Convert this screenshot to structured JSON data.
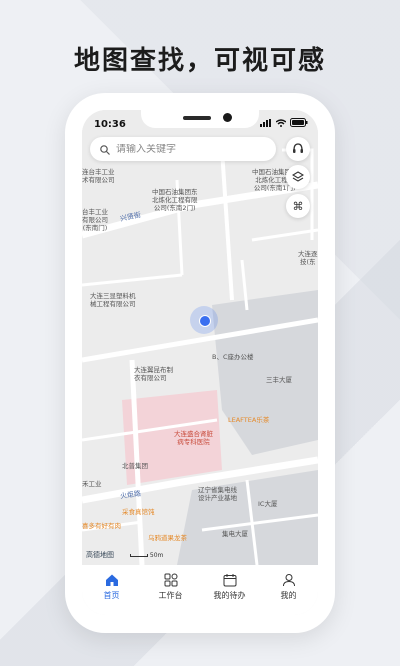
{
  "headline": "地图查找，可视可感",
  "status": {
    "time": "10:36"
  },
  "search": {
    "placeholder": "请输入关键字"
  },
  "map": {
    "roads": [
      "兴贤街",
      "火炬路",
      "黎贤街",
      "黄贤街"
    ],
    "pois": [
      {
        "name": "中国石油集团东北炼化工程有限公司(东南2门)",
        "lines": [
          "中国石油集团东",
          "北炼化工程有限",
          "公司(东南2门)"
        ],
        "color": "blue"
      },
      {
        "name": "中国石油集团东北炼化工程有限公司(东南1门)",
        "lines": [
          "中国石油集团东",
          "北炼化工程有",
          "公司(东南1门)"
        ],
        "color": "blue"
      },
      {
        "name": "大连台丰工业技术有限公司",
        "lines": [
          "连台丰工业",
          "术有限公司"
        ],
        "color": "gray"
      },
      {
        "name": "大连台丰工业有限公司(东南门)",
        "lines": [
          "台丰工业",
          "有限公司",
          "(东南门)"
        ],
        "color": "gray"
      },
      {
        "name": "大连三显塑料机械工程有限公司",
        "lines": [
          "大连三显塑料机",
          "械工程有限公司"
        ],
        "color": "gray"
      },
      {
        "name": "大连逐佳科技",
        "lines": [
          "大连逐",
          "技(东"
        ],
        "color": "gray"
      },
      {
        "name": "B、C座办公楼",
        "lines": [
          "B、C座办公楼"
        ],
        "color": "gray"
      },
      {
        "name": "大连翼昆布制衣有限公司",
        "lines": [
          "大连翼昆布制",
          "衣有限公司"
        ],
        "color": "gray"
      },
      {
        "name": "三丰大厦",
        "lines": [
          "三丰大厦"
        ],
        "color": "gray"
      },
      {
        "name": "LEAFTEA乐茶",
        "lines": [
          "LEAFTEA乐茶"
        ],
        "color": "orange"
      },
      {
        "name": "大连盛合肾脏病专科医院",
        "lines": [
          "大连盛合肾脏",
          "病专科医院"
        ],
        "color": "red"
      },
      {
        "name": "北普集团",
        "lines": [
          "北普集团"
        ],
        "color": "gray"
      },
      {
        "name": "辽宁省集电线设计产业基地",
        "lines": [
          "辽宁省集电线",
          "设计产业基地"
        ],
        "color": "gray"
      },
      {
        "name": "IC大厦",
        "lines": [
          "IC大厦"
        ],
        "color": "gray"
      },
      {
        "name": "集电大厦",
        "lines": [
          "集电大厦"
        ],
        "color": "gray"
      },
      {
        "name": "采食真馆饨",
        "lines": [
          "采食真馆饨"
        ],
        "color": "orange"
      },
      {
        "name": "喜多有好有肉",
        "lines": [
          "喜多有好有肉"
        ],
        "color": "orange"
      },
      {
        "name": "乌鸦道果龙茶",
        "lines": [
          "乌鸦道果龙茶"
        ],
        "color": "orange"
      },
      {
        "name": "禾工业",
        "lines": [
          "禾工业"
        ],
        "color": "gray"
      }
    ],
    "scale_label": "50m",
    "logo": "高德地图"
  },
  "tabs": [
    {
      "label": "首页",
      "icon": "home-icon",
      "active": true
    },
    {
      "label": "工作台",
      "icon": "grid-icon",
      "active": false
    },
    {
      "label": "我的待办",
      "icon": "calendar-icon",
      "active": false
    },
    {
      "label": "我的",
      "icon": "person-icon",
      "active": false
    }
  ],
  "colors": {
    "accent": "#2a6ae0",
    "hospital": "#f3d3d8",
    "map_bg": "#ececec"
  }
}
